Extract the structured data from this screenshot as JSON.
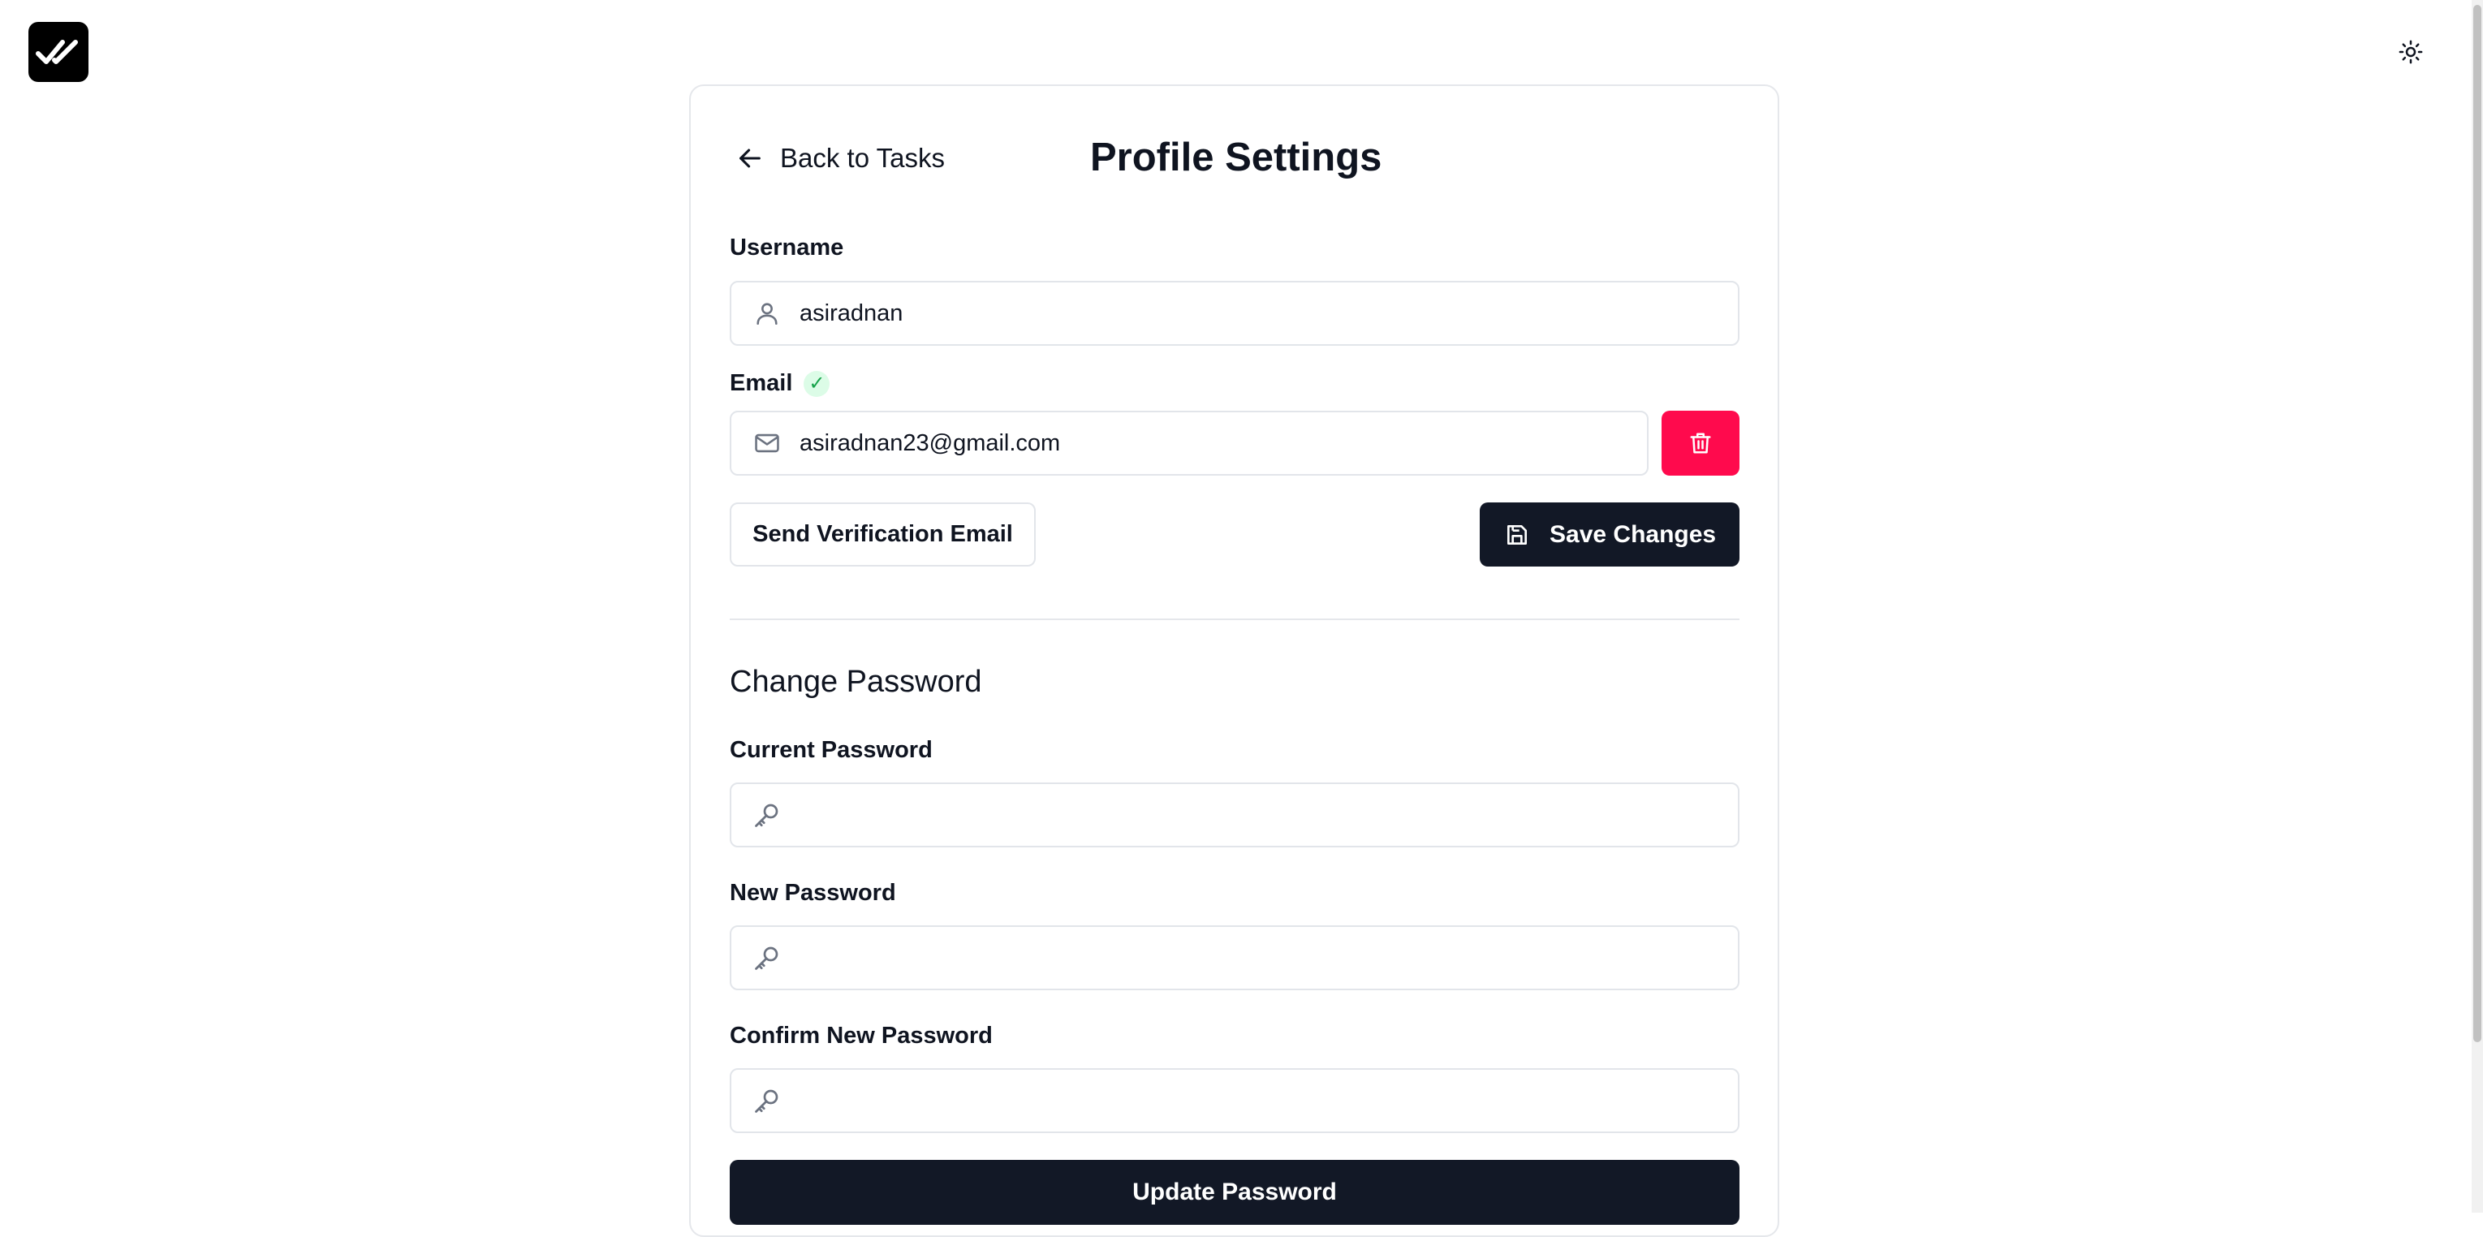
{
  "app": {
    "logo_icon": "double-check-icon"
  },
  "header": {
    "theme_toggle_icon": "sun-icon"
  },
  "page": {
    "back_label": "Back to Tasks",
    "title": "Profile Settings"
  },
  "profile": {
    "username_label": "Username",
    "username_value": "asiradnan",
    "email_label": "Email",
    "email_verified_mark": "✓",
    "email_value": "asiradnan23@gmail.com",
    "send_verification_label": "Send Verification Email",
    "save_label": "Save Changes"
  },
  "password": {
    "section_title": "Change Password",
    "current_label": "Current Password",
    "new_label": "New Password",
    "confirm_label": "Confirm New Password",
    "current_value": "",
    "new_value": "",
    "confirm_value": "",
    "update_label": "Update Password"
  },
  "colors": {
    "primary_dark": "#121826",
    "danger": "#ff0a4d",
    "success": "#16a34a",
    "border": "#e2e5ea"
  }
}
